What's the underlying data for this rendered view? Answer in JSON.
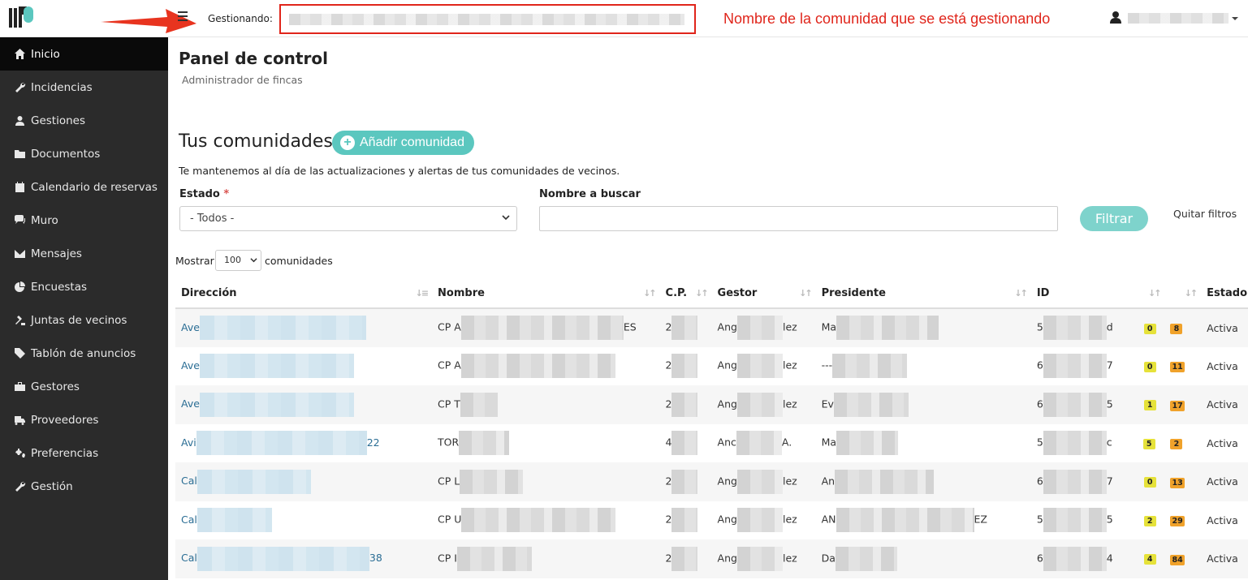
{
  "topbar": {
    "gestionando_label": "Gestionando:",
    "annotation": "Nombre de la comunidad que se está gestionando"
  },
  "sidebar": {
    "items": [
      {
        "label": "Inicio",
        "icon": "home-icon",
        "active": true
      },
      {
        "label": "Incidencias",
        "icon": "wrench-icon"
      },
      {
        "label": "Gestiones",
        "icon": "users-icon"
      },
      {
        "label": "Documentos",
        "icon": "folder-icon"
      },
      {
        "label": "Calendario de reservas",
        "icon": "calendar-icon"
      },
      {
        "label": "Muro",
        "icon": "comments-icon"
      },
      {
        "label": "Mensajes",
        "icon": "envelope-icon"
      },
      {
        "label": "Encuestas",
        "icon": "pie-chart-icon"
      },
      {
        "label": "Juntas de vecinos",
        "icon": "gavel-icon"
      },
      {
        "label": "Tablón de anuncios",
        "icon": "tag-icon"
      },
      {
        "label": "Gestores",
        "icon": "briefcase-icon"
      },
      {
        "label": "Proveedores",
        "icon": "truck-icon"
      },
      {
        "label": "Preferencias",
        "icon": "cogs-icon"
      },
      {
        "label": "Gestión",
        "icon": "wrench-icon"
      }
    ]
  },
  "main": {
    "title": "Panel de control",
    "subtitle": "Administrador de fincas",
    "section_title": "Tus comunidades:",
    "add_button": "Añadir comunidad",
    "intro": "Te mantenemos al día de las actualizaciones y alertas de tus comunidades de vecinos.",
    "estado_label": "Estado",
    "estado_required": "*",
    "estado_value": "- Todos -",
    "nombre_label": "Nombre a buscar",
    "filtrar": "Filtrar",
    "quitar": "Quitar filtros",
    "mostrar": "Mostrar",
    "page_len": "100",
    "comunidades": "comunidades"
  },
  "table": {
    "headers": [
      "Dirección",
      "Nombre",
      "C.P.",
      "Gestor",
      "Presidente",
      "ID",
      "",
      "",
      "Estado"
    ],
    "rows": [
      {
        "dir_pre": "Ave",
        "dir_suf": "",
        "nom_pre": "CP A",
        "nom_suf": "ES",
        "cp": "2",
        "gestor_pre": "Ang",
        "gestor_suf": "lez",
        "pres_pre": "Ma",
        "pres_suf": "",
        "id_pre": "5",
        "id_suf": "d",
        "b1": "0",
        "b2": "8",
        "estado": "Activa"
      },
      {
        "dir_pre": "Ave",
        "dir_suf": "",
        "nom_pre": "CP A",
        "nom_suf": "",
        "cp": "2",
        "gestor_pre": "Ang",
        "gestor_suf": "lez",
        "pres_pre": "---",
        "pres_suf": "",
        "id_pre": "6",
        "id_suf": "7",
        "b1": "0",
        "b2": "11",
        "estado": "Activa"
      },
      {
        "dir_pre": "Ave",
        "dir_suf": "",
        "nom_pre": "CP T",
        "nom_suf": "",
        "cp": "2",
        "gestor_pre": "Ang",
        "gestor_suf": "lez",
        "pres_pre": "Ev",
        "pres_suf": "",
        "id_pre": "6",
        "id_suf": "5",
        "b1": "1",
        "b2": "17",
        "estado": "Activa"
      },
      {
        "dir_pre": "Avi",
        "dir_suf": "22",
        "nom_pre": "TOR",
        "nom_suf": "",
        "cp": "4",
        "gestor_pre": "Anc",
        "gestor_suf": "A.",
        "pres_pre": "Ma",
        "pres_suf": "",
        "id_pre": "5",
        "id_suf": "c",
        "b1": "5",
        "b2": "2",
        "estado": "Activa"
      },
      {
        "dir_pre": "Cal",
        "dir_suf": "",
        "nom_pre": "CP L",
        "nom_suf": "",
        "cp": "2",
        "gestor_pre": "Ang",
        "gestor_suf": "lez",
        "pres_pre": "An",
        "pres_suf": "",
        "id_pre": "6",
        "id_suf": "7",
        "b1": "0",
        "b2": "13",
        "estado": "Activa"
      },
      {
        "dir_pre": "Cal",
        "dir_suf": "",
        "nom_pre": "CP U",
        "nom_suf": "",
        "cp": "2",
        "gestor_pre": "Ang",
        "gestor_suf": "lez",
        "pres_pre": "AN",
        "pres_suf": "EZ",
        "id_pre": "5",
        "id_suf": "5",
        "b1": "2",
        "b2": "29",
        "estado": "Activa"
      },
      {
        "dir_pre": "Cal",
        "dir_suf": "38",
        "nom_pre": "CP I",
        "nom_suf": "",
        "cp": "2",
        "gestor_pre": "Ang",
        "gestor_suf": "lez",
        "pres_pre": "Da",
        "pres_suf": "",
        "id_pre": "6",
        "id_suf": "4",
        "b1": "4",
        "b2": "84",
        "estado": "Activa"
      }
    ]
  },
  "colors": {
    "accent": "#5bc7bf",
    "annotation": "#e0251b",
    "sidebar": "#2b2b2b",
    "link": "#2a6d94"
  }
}
